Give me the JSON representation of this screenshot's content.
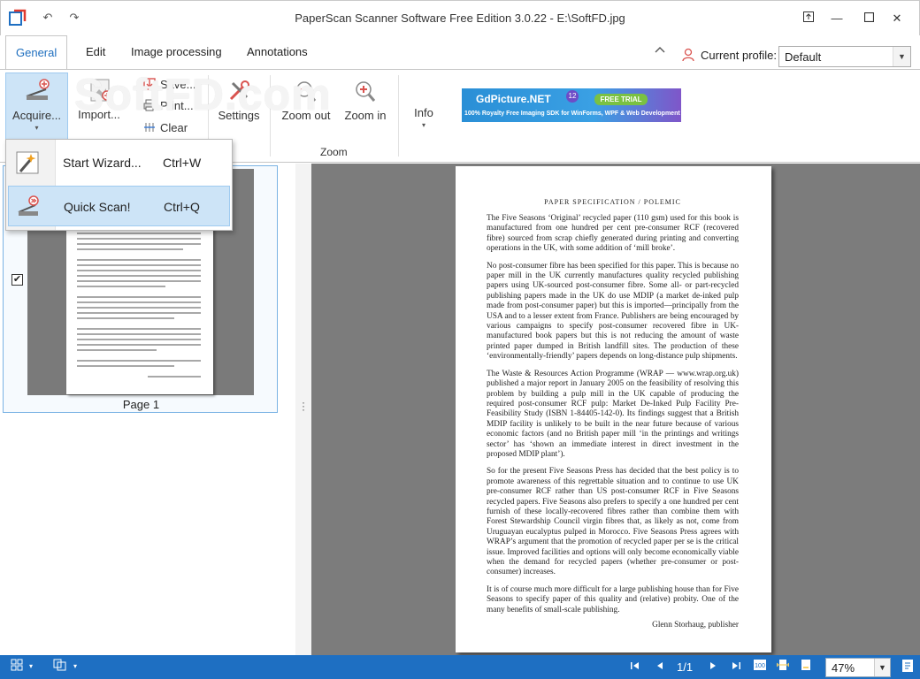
{
  "window": {
    "title": "PaperScan Scanner Software Free Edition 3.0.22 - E:\\SoftFD.jpg",
    "undo_glyph": "↶",
    "redo_glyph": "↷",
    "restore_glyph": "⬚",
    "minimize_glyph": "—",
    "maximize_glyph": "☐",
    "close_glyph": "✕"
  },
  "tabs": [
    {
      "label": "General",
      "active": true
    },
    {
      "label": "Edit",
      "active": false
    },
    {
      "label": "Image processing",
      "active": false
    },
    {
      "label": "Annotations",
      "active": false
    }
  ],
  "profile": {
    "label": "Current profile:",
    "value": "Default"
  },
  "ribbon": {
    "acquire": "Acquire...",
    "import": "Import...",
    "save": "Save...",
    "print": "Print...",
    "clear": "Clear",
    "settings": "Settings",
    "zoom_out": "Zoom out",
    "zoom_in": "Zoom in",
    "info": "Info",
    "zoom_group": "Zoom",
    "watermark": "SoftFD.com"
  },
  "banner": {
    "brand": "GdPicture.NET",
    "badge": "12",
    "cta": "FREE TRIAL",
    "tagline": "100% Royalty Free Imaging SDK for WinForms, WPF & Web Development"
  },
  "acquire_menu": [
    {
      "label": "Start Wizard...",
      "shortcut": "Ctrl+W",
      "active": false
    },
    {
      "label": "Quick Scan!",
      "shortcut": "Ctrl+Q",
      "active": true
    }
  ],
  "thumbnails": [
    {
      "label": "Page 1",
      "checked": true,
      "check_glyph": "✔"
    }
  ],
  "document": {
    "header": "PAPER SPECIFICATION / POLEMIC",
    "paragraphs": [
      "The Five Seasons ‘Original’ recycled paper (110 gsm) used for this book is manufactured from one hundred per cent pre-consumer RCF (recovered fibre) sourced from scrap chiefly generated during printing and converting operations in the UK, with some addition of ‘mill broke’.",
      "No post-consumer fibre has been specified for this paper. This is because no paper mill in the UK currently manufactures quality recycled publishing papers using UK-sourced post-consumer fibre. Some all- or part-recycled publishing papers made in the UK do use MDIP (a market de-inked pulp made from post-consumer paper) but this is imported—principally from the USA and to a lesser extent from France. Publishers are being encouraged by various campaigns to specify post-consumer recovered fibre in UK-manufactured book papers but this is not reducing the amount of waste printed paper dumped in British landfill sites. The production of these ‘environmentally-friendly’ papers depends on long-distance pulp shipments.",
      "The Waste & Resources Action Programme (WRAP — www.wrap.org.uk) published a major report in January 2005 on the feasibility of resolving this problem by building a pulp mill in the UK capable of producing the required post-consumer RCF pulp: Market De-Inked Pulp Facility Pre-Feasibility Study (ISBN 1-84405-142-0). Its findings suggest that a British MDIP facility is unlikely to be built in the near future because of various economic factors (and no British paper mill ‘in the printings and writings sector’ has ‘shown an immediate interest in direct investment in the proposed MDIP plant’).",
      "So for the present Five Seasons Press has decided that the best policy is to promote awareness of this regrettable situation and to continue to use UK pre-consumer RCF rather than US post-consumer RCF in Five Seasons recycled papers. Five Seasons also prefers to specify a one hundred per cent furnish of these locally-recovered fibres rather than combine them with Forest Stewardship Council virgin fibres that, as likely as not, come from Uruguayan eucalyptus pulped in Morocco. Five Seasons Press agrees with WRAP’s argument that the promotion of recycled paper per se is the critical issue. Improved facilities and options will only become economically viable when the demand for recycled papers (whether pre-consumer or post-consumer) increases.",
      "It is of course much more difficult for a large publishing house than for Five Seasons to specify paper of this quality and (relative) probity. One of the many benefits of small-scale publishing."
    ],
    "signature": "Glenn Storhaug, publisher"
  },
  "statusbar": {
    "page_indicator": "1/1",
    "zoom": "47%"
  },
  "colors": {
    "accent": "#1f6fbf",
    "statusbar": "#1e6fc2",
    "highlight": "#cde4f7",
    "viewer_bg": "#7c7c7c"
  }
}
